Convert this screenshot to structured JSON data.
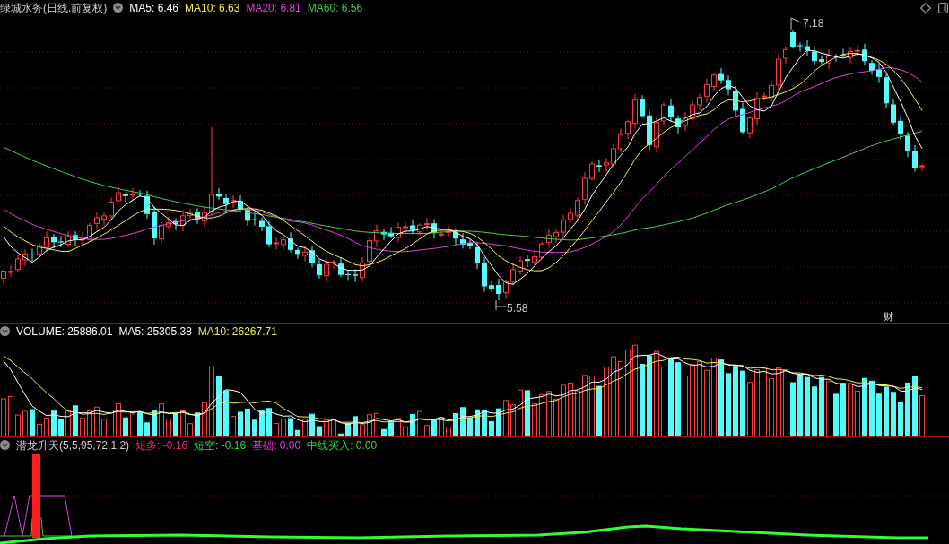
{
  "price_panel": {
    "title": "绿城水务(日线.前复权)",
    "legend": [
      {
        "label": "MA5: 6.46",
        "color": "#ffffff"
      },
      {
        "label": "MA10: 6.63",
        "color": "#f0f050"
      },
      {
        "label": "MA20: 6.81",
        "color": "#e040e0"
      },
      {
        "label": "MA60: 6.56",
        "color": "#40d040"
      }
    ],
    "high_label": "7.18",
    "low_label": "5.58",
    "marker": "财"
  },
  "volume_panel": {
    "legend": [
      {
        "label": "VOLUME: 25886.01",
        "color": "#ffffff"
      },
      {
        "label": "MA5: 25305.38",
        "color": "#ffffff"
      },
      {
        "label": "MA10: 26267.71",
        "color": "#f0f050"
      }
    ]
  },
  "indicator_panel": {
    "title": "潜龙升天(5,5,95,72,1,2)",
    "legend": [
      {
        "label": "短多: -0.16",
        "color": "#e8306a"
      },
      {
        "label": "短空: -0.16",
        "color": "#40d040"
      },
      {
        "label": "基础: 0.00",
        "color": "#e040e0"
      },
      {
        "label": "中线买入: 0.00",
        "color": "#40d040"
      }
    ]
  }
}
